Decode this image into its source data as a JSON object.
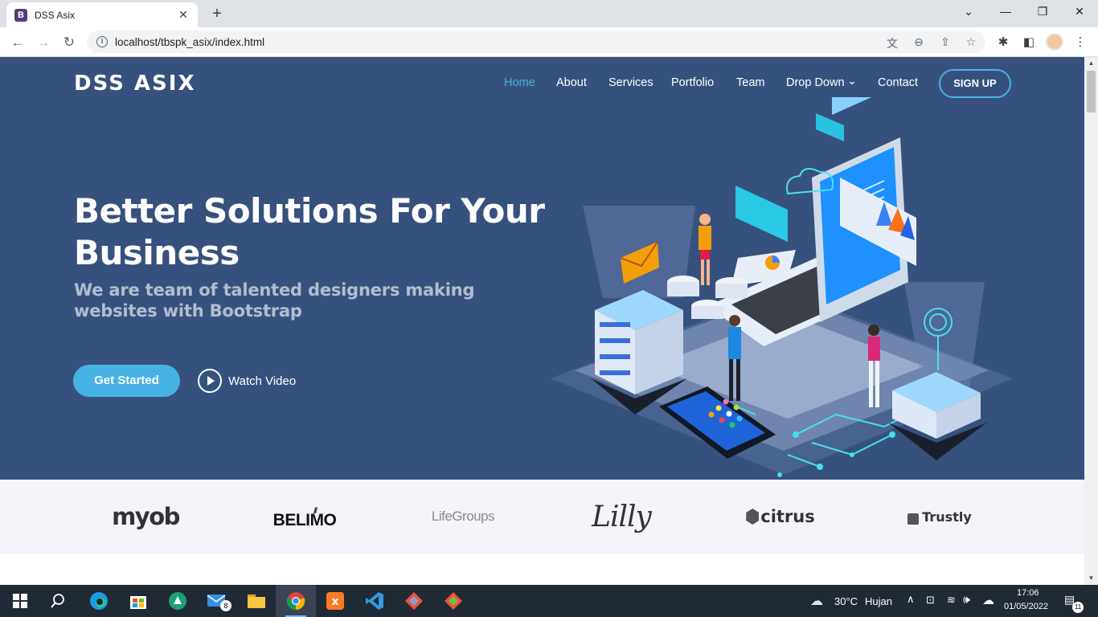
{
  "browser": {
    "tab_title": "DSS Asix",
    "tab_favicon": "B",
    "url": "localhost/tbspk_asix/index.html"
  },
  "page": {
    "logo": "DSS ASIX",
    "nav": [
      {
        "label": "Home",
        "active": true
      },
      {
        "label": "About",
        "active": false
      },
      {
        "label": "Services",
        "active": false
      },
      {
        "label": "Portfolio",
        "active": false
      },
      {
        "label": "Team",
        "active": false
      },
      {
        "label": "Drop Down",
        "active": false
      },
      {
        "label": "Contact",
        "active": false
      }
    ],
    "signup": "SIGN UP",
    "hero_title": "Better Solutions For Your Business",
    "hero_subtitle": "We are team of talented designers making websites with Bootstrap",
    "get_started": "Get Started",
    "watch_video": "Watch Video",
    "clients": [
      "myob",
      "BELIMO",
      "LifeGroups",
      "Lilly",
      "citrus",
      "Trustly"
    ]
  },
  "taskbar": {
    "weather_temp": "30°C",
    "weather_desc": "Hujan",
    "time": "17:06",
    "date": "01/05/2022",
    "mail_badge": "8",
    "notif_count": "11"
  },
  "colors": {
    "hero_bg": "#37517e",
    "accent": "#47b2e4",
    "clients_bg": "#f3f5fa"
  }
}
